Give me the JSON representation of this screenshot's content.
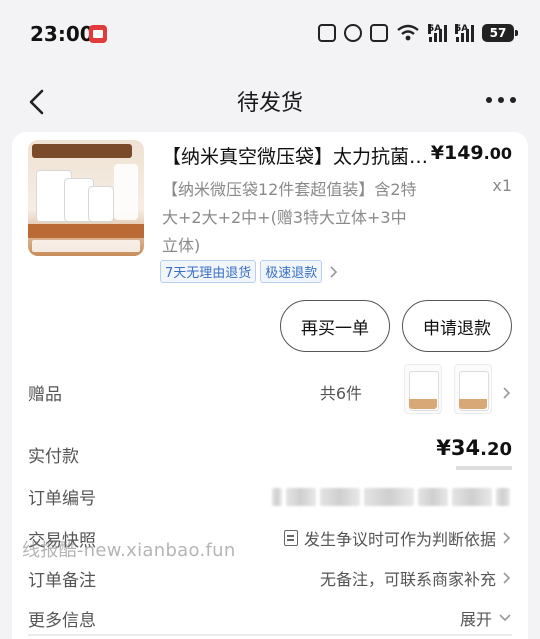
{
  "status_bar": {
    "time": "23:00",
    "signal1_label": "5A",
    "signal2_label": "5A",
    "battery": "57"
  },
  "nav": {
    "title": "待发货"
  },
  "product": {
    "title": "【纳米真空微压袋】太力抗菌防霉",
    "price_int": "¥149",
    "price_dec": ".00",
    "spec": "【纳米微压袋12件套超值装】含2特大+2大+2中+(赠3特大立体+3中立体)",
    "qty": "x1",
    "tags": [
      "7天无理由退货",
      "极速退款"
    ]
  },
  "actions": {
    "rebuy": "再买一单",
    "refund": "申请退款"
  },
  "rows": {
    "gift_label": "赠品",
    "gift_count": "共6件",
    "paid_label": "实付款",
    "paid_int": "¥34",
    "paid_dec": ".20",
    "order_no_label": "订单编号",
    "snapshot_label": "交易快照",
    "snapshot_value": "发生争议时可作为判断依据",
    "remark_label": "订单备注",
    "remark_value": "无备注，可联系商家补充",
    "more_label": "更多信息",
    "more_value": "展开"
  },
  "watermark": "线报酷-new.xianbao.fun"
}
